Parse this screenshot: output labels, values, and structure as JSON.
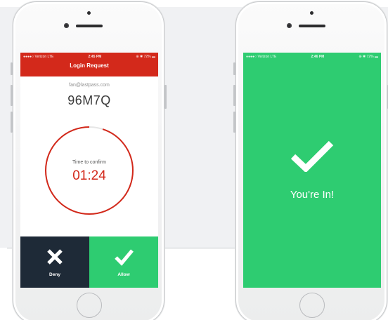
{
  "colors": {
    "brand_red": "#d3291b",
    "success_green": "#2ecc71",
    "deny_navy": "#1e2a37"
  },
  "login_screen": {
    "status_bar": {
      "carrier": "●●●●○ Verizon  LTE",
      "time": "2:45 PM",
      "battery": "⊕ ✱ 72% ▬"
    },
    "header_title": "Login Request",
    "email": "fan@lastpass.com",
    "code": "96M7Q",
    "timer": {
      "label": "Time to confirm",
      "value": "01:24",
      "remaining_fraction": 0.95
    },
    "deny_label": "Deny",
    "allow_label": "Allow",
    "deny_icon": "close-icon",
    "allow_icon": "checkmark-icon"
  },
  "success_screen": {
    "status_bar": {
      "carrier": "●●●●○ Verizon  LTE",
      "time": "2:46 PM",
      "battery": "⊕ ✱ 72% ▬"
    },
    "icon": "checkmark-icon",
    "message": "You're In!"
  }
}
